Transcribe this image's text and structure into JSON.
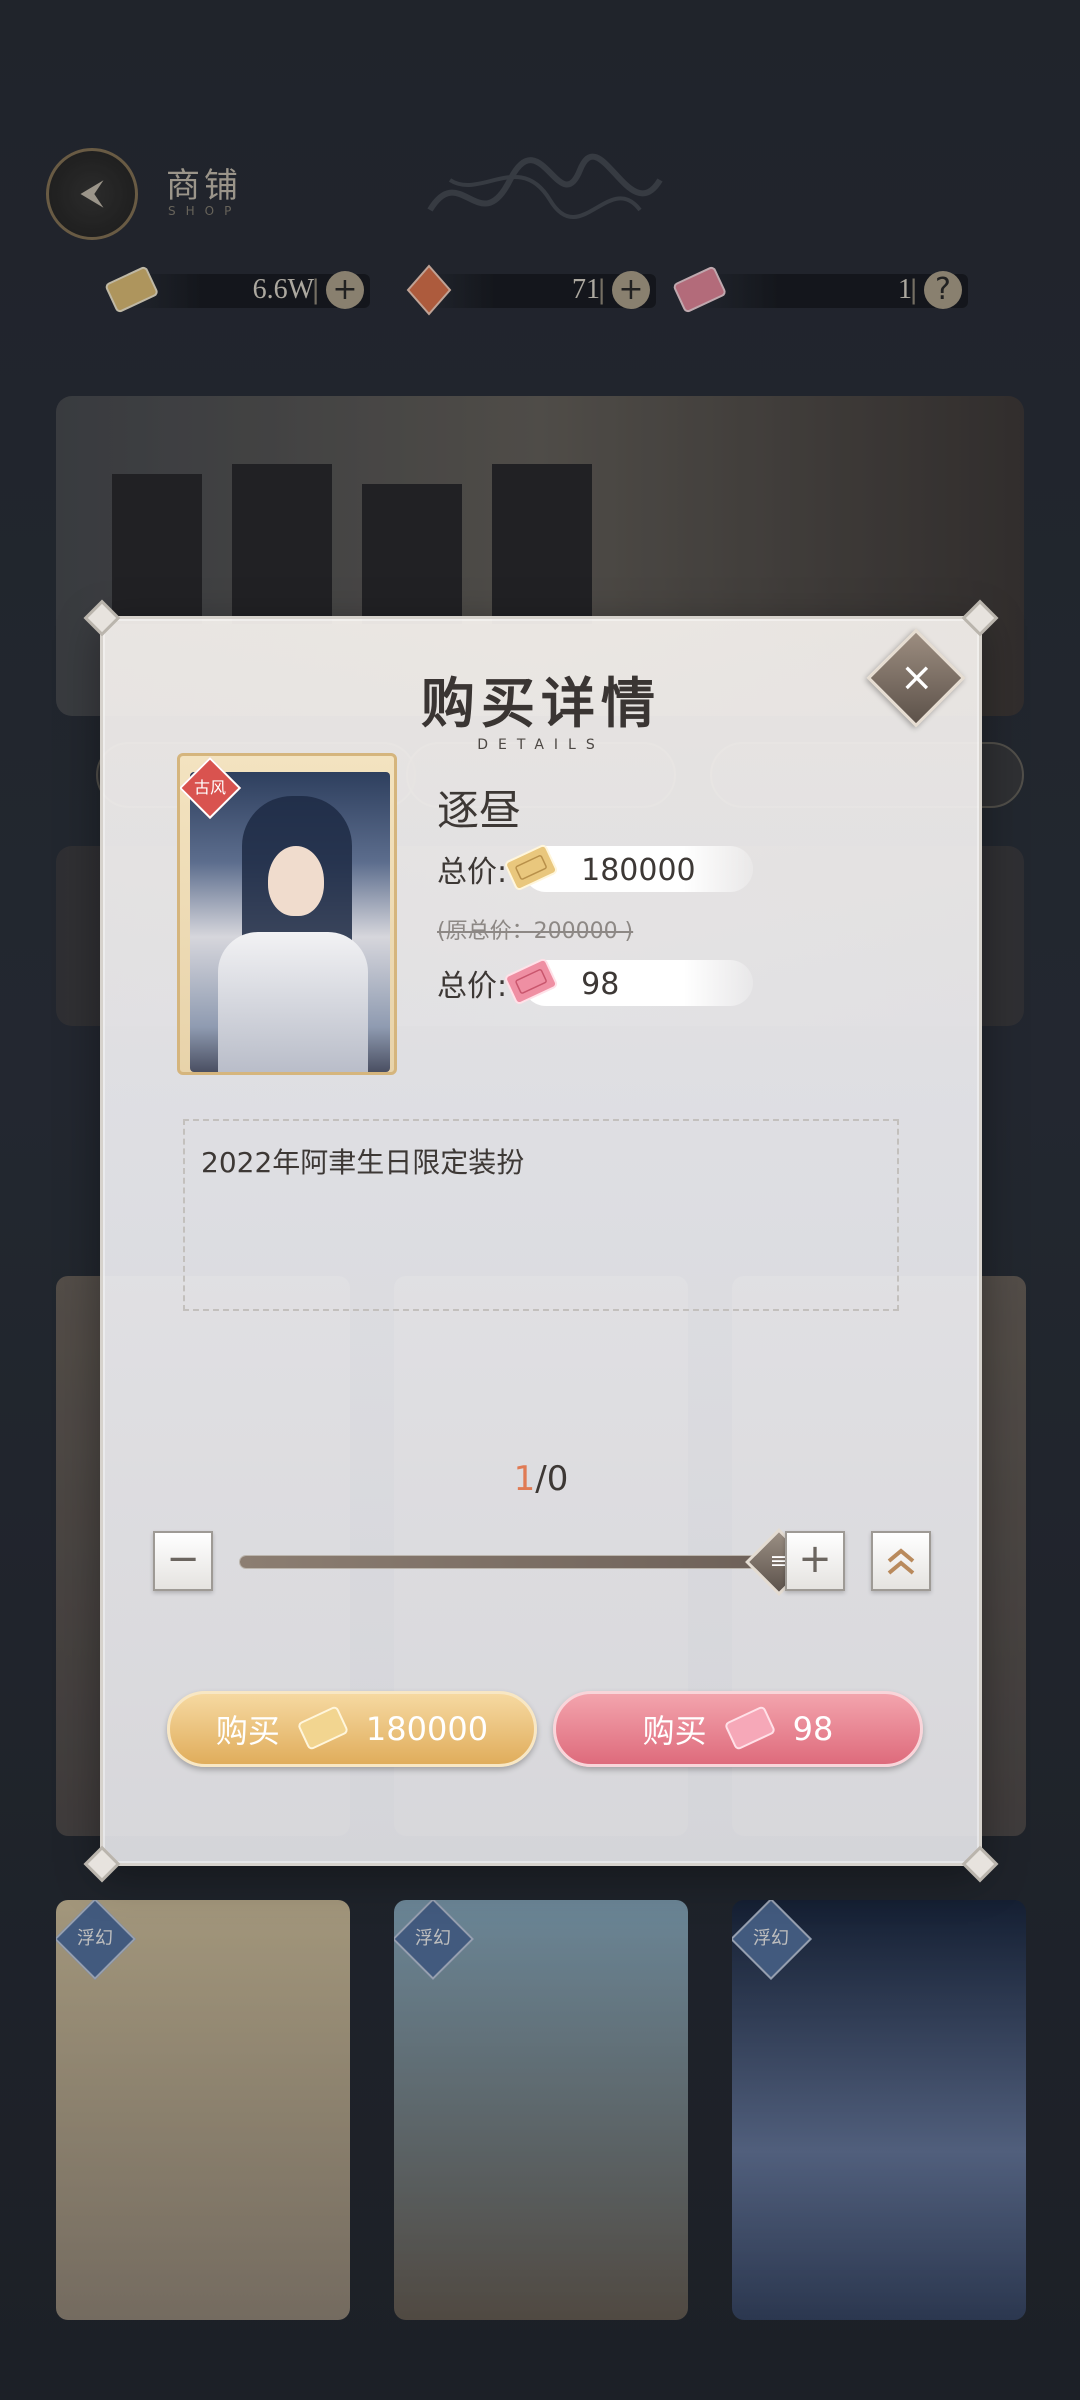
{
  "header": {
    "title": "商铺",
    "subtitle": "SHOP"
  },
  "currency": {
    "coins": "6.6W",
    "gems": "71",
    "points": "1"
  },
  "modal": {
    "title": "购买详情",
    "subtitle": "DETAILS",
    "item_tag": "古风",
    "item_name": "逐昼",
    "price_label": "总价:",
    "coin_price": "180000",
    "original_price": "(原总价：200000 )",
    "point_price": "98",
    "description": "2022年阿聿生日限定装扮",
    "quantity_current": "1",
    "quantity_sep": "/",
    "quantity_max": "0",
    "slider_fraction": 1.0,
    "buy_label": "购买",
    "buy_coin_amount": "180000",
    "buy_point_amount": "98"
  },
  "bottom_cards": [
    {
      "tag": "浮幻"
    },
    {
      "tag": "浮幻"
    },
    {
      "tag": "浮幻"
    }
  ],
  "colors": {
    "accent_gold": "#e0ad5c",
    "accent_pink": "#de6b7c",
    "qty_highlight": "#e07b55"
  }
}
